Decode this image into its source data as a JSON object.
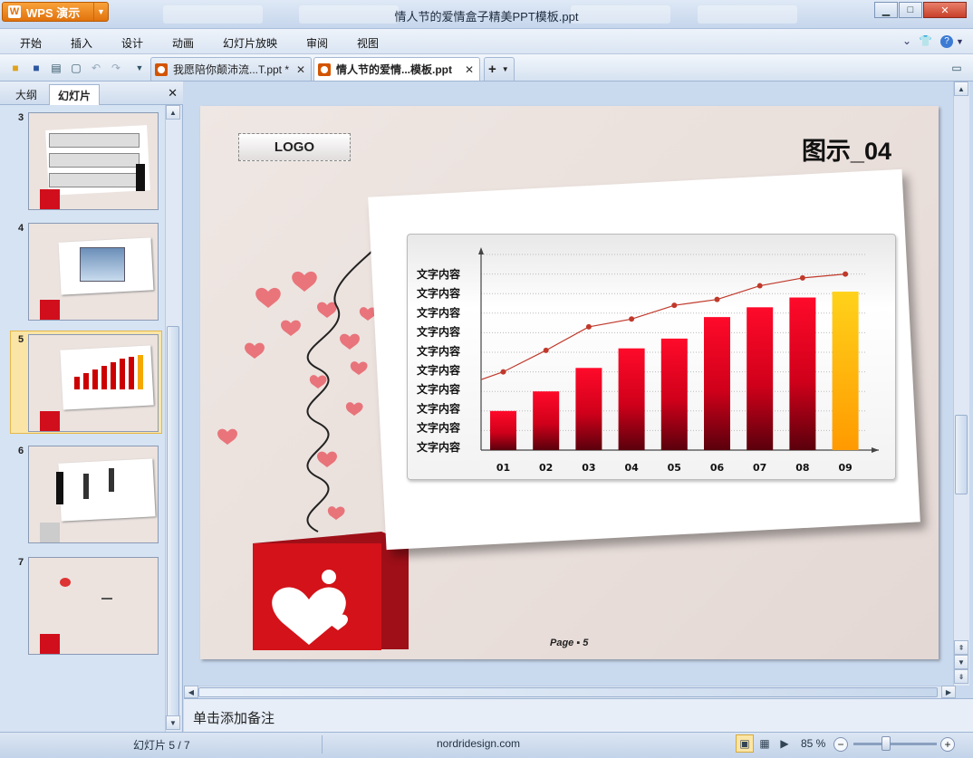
{
  "app": {
    "button_label": "WPS 演示",
    "window_title": "情人节的爱情盒子精美PPT模板.ppt"
  },
  "window_controls": {
    "minimize": "▁",
    "maximize": "□",
    "close": "✕"
  },
  "menu": [
    "开始",
    "插入",
    "设计",
    "动画",
    "幻灯片放映",
    "审阅",
    "视图"
  ],
  "tabs": [
    {
      "label": "我愿陪你颠沛流...T.ppt *",
      "close": "✕",
      "active": false
    },
    {
      "label": "情人节的爱情...模板.ppt",
      "close": "✕",
      "active": true
    }
  ],
  "tab_add": "+",
  "left_pane": {
    "tab_outline": "大纲",
    "tab_slides": "幻灯片",
    "close": "✕",
    "slides": [
      {
        "num": "3",
        "selected": false
      },
      {
        "num": "4",
        "selected": false
      },
      {
        "num": "5",
        "selected": true
      },
      {
        "num": "6",
        "selected": false
      },
      {
        "num": "7",
        "selected": false
      }
    ]
  },
  "slide": {
    "logo": "LOGO",
    "title": "图示_04",
    "page": "Page ▪ 5"
  },
  "chart_data": {
    "type": "bar",
    "categories": [
      "01",
      "02",
      "03",
      "04",
      "05",
      "06",
      "07",
      "08",
      "09"
    ],
    "series": [
      {
        "values": [
          20,
          30,
          42,
          52,
          57,
          68,
          73,
          78,
          81
        ]
      },
      {
        "values": [
          40,
          51,
          63,
          67,
          74,
          77,
          84,
          88,
          90
        ]
      }
    ],
    "y_labels": [
      "文字内容",
      "文字内容",
      "文字内容",
      "文字内容",
      "文字内容",
      "文字内容",
      "文字内容",
      "文字内容",
      "文字内容",
      "文字内容"
    ],
    "ylim": [
      0,
      100
    ],
    "colors": {
      "bar": "#d8001a",
      "bar_highlight": "#ffb400",
      "line": "#c0392b"
    }
  },
  "notes": {
    "placeholder": "单击添加备注"
  },
  "status": {
    "slide_counter": "幻灯片 5 / 7",
    "template": "nordridesign.com",
    "zoom": "85 %"
  }
}
